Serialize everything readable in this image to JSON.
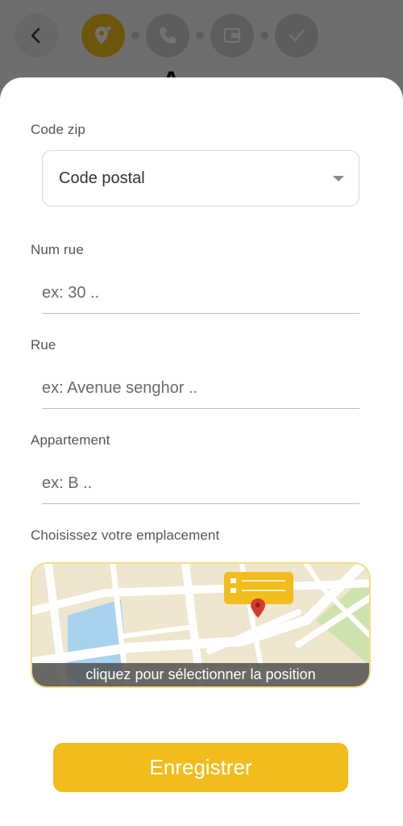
{
  "backdrop": {
    "title": "A",
    "stepper": {
      "steps": [
        {
          "icon": "location-add-icon",
          "active": true
        },
        {
          "icon": "phone-icon",
          "active": false
        },
        {
          "icon": "wallet-icon",
          "active": false
        },
        {
          "icon": "check-icon",
          "active": false
        }
      ]
    }
  },
  "form": {
    "zip": {
      "label": "Code zip",
      "value": "Code postal"
    },
    "street_number": {
      "label": "Num rue",
      "placeholder": "ex: 30 .."
    },
    "street": {
      "label": "Rue",
      "placeholder": "ex: Avenue senghor .."
    },
    "apartment": {
      "label": "Appartement",
      "placeholder": "ex: B .."
    },
    "location": {
      "label": "Choisissez votre emplacement",
      "map_caption": "cliquez pour sélectionner la position"
    },
    "save_label": "Enregistrer"
  },
  "colors": {
    "accent": "#f2bd1c",
    "pin": "#d63a2f"
  }
}
